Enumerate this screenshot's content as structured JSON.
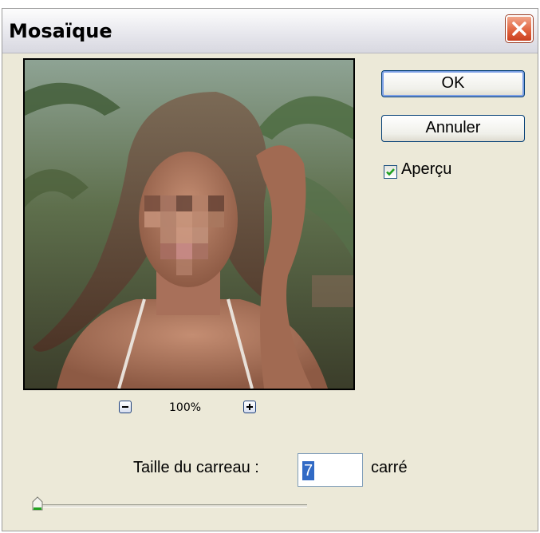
{
  "window": {
    "title": "Mosaïque"
  },
  "buttons": {
    "ok": "OK",
    "cancel": "Annuler"
  },
  "preview_toggle": {
    "label": "Aperçu",
    "checked": true
  },
  "zoom": {
    "level": "100%"
  },
  "tile_size": {
    "label": "Taille du carreau :",
    "value": "7",
    "unit": "carré"
  },
  "slider": {
    "fraction": 0.01
  },
  "colors": {
    "accent": "#316ac5",
    "close": "#e0613c",
    "check": "#21a121"
  },
  "icons": {
    "close": "close-icon",
    "zoom_out": "minus-icon",
    "zoom_in": "plus-icon",
    "check": "check-icon"
  }
}
